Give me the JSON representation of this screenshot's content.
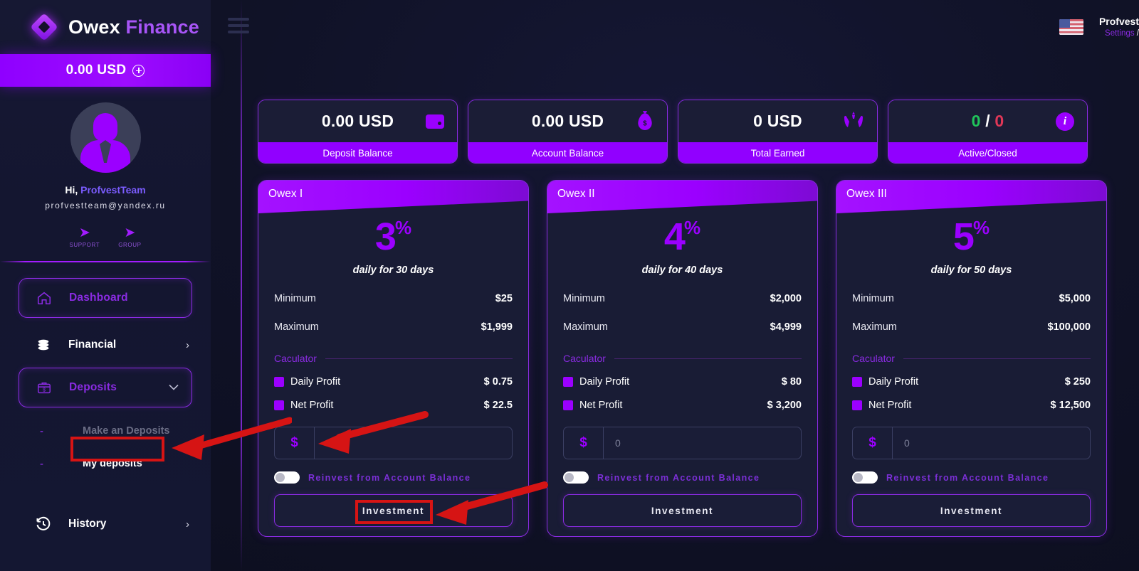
{
  "brand": {
    "word1": "Owex",
    "word2": "Finance",
    "logo_icon": "diamond-logo-icon"
  },
  "topbar": {
    "menu_icon": "hamburger-menu-icon",
    "flag_icon": "us-flag-icon",
    "user_name": "Profvest",
    "settings_label": "Settings",
    "separator": "/"
  },
  "sidebar": {
    "balance": {
      "label": "0.00 USD",
      "add_icon": "plus-circle-icon"
    },
    "profile": {
      "avatar_icon": "user-avatar-icon",
      "greeting": "Hi,",
      "username": "ProfvestTeam",
      "email": "profvestteam@yandex.ru"
    },
    "socials": [
      {
        "icon": "telegram-icon",
        "label": "SUPPORT"
      },
      {
        "icon": "telegram-icon",
        "label": "GROUP"
      }
    ],
    "nav": [
      {
        "label": "Dashboard",
        "icon": "home-icon",
        "style": "active-box",
        "chevron": ""
      },
      {
        "label": "Financial",
        "icon": "coins-icon",
        "style": "plain",
        "chevron": "›"
      },
      {
        "label": "Deposits",
        "icon": "deposit-box-icon",
        "style": "active-box",
        "chevron": "⌄"
      }
    ],
    "sub_items": [
      {
        "dash": "-",
        "label": "Make an Deposits",
        "state": "dim"
      },
      {
        "dash": "-",
        "label": "My deposits",
        "state": "bright"
      }
    ],
    "history": {
      "label": "History",
      "icon": "history-clock-icon",
      "chevron": "›"
    }
  },
  "stats": [
    {
      "value": "0.00 USD",
      "label": "Deposit Balance",
      "icon": "wallet-icon"
    },
    {
      "value": "0.00 USD",
      "label": "Account Balance",
      "icon": "money-bag-icon"
    },
    {
      "value": "0 USD",
      "label": "Total Earned",
      "icon": "hands-money-icon"
    },
    {
      "value_active": "0",
      "value_sep": "/",
      "value_closed": "0",
      "label": "Active/Closed",
      "icon": "info-icon"
    }
  ],
  "plans": [
    {
      "title": "Owex I",
      "percent_number": "3",
      "percent_symbol": "%",
      "subtitle": "daily for 30 days",
      "min_label": "Minimum",
      "min_value": "$25",
      "max_label": "Maximum",
      "max_value": "$1,999",
      "calc_label": "Caculator",
      "daily_label": "Daily Profit",
      "daily_value": "$ 0.75",
      "net_label": "Net Profit",
      "net_value": "$ 22.5",
      "currency": "$",
      "amount_placeholder": "0",
      "amount_value": "",
      "reinvest_label": "Reinvest from Account Balance",
      "button_label": "Investment"
    },
    {
      "title": "Owex II",
      "percent_number": "4",
      "percent_symbol": "%",
      "subtitle": "daily for 40 days",
      "min_label": "Minimum",
      "min_value": "$2,000",
      "max_label": "Maximum",
      "max_value": "$4,999",
      "calc_label": "Caculator",
      "daily_label": "Daily Profit",
      "daily_value": "$ 80",
      "net_label": "Net Profit",
      "net_value": "$ 3,200",
      "currency": "$",
      "amount_placeholder": "0",
      "amount_value": "",
      "reinvest_label": "Reinvest from Account Balance",
      "button_label": "Investment"
    },
    {
      "title": "Owex III",
      "percent_number": "5",
      "percent_symbol": "%",
      "subtitle": "daily for 50 days",
      "min_label": "Minimum",
      "min_value": "$5,000",
      "max_label": "Maximum",
      "max_value": "$100,000",
      "calc_label": "Caculator",
      "daily_label": "Daily Profit",
      "daily_value": "$ 250",
      "net_label": "Net Profit",
      "net_value": "$ 12,500",
      "currency": "$",
      "amount_placeholder": "0",
      "amount_value": "",
      "reinvest_label": "Reinvest from Account Balance",
      "button_label": "Investment"
    }
  ],
  "colors": {
    "accent_purple": "#9b00ff",
    "border_purple": "#8a2be2",
    "bg_dark": "#0e1022",
    "panel": "#191c35",
    "green": "#20c45a",
    "red": "#e03757",
    "annotation_red": "#d61414"
  }
}
